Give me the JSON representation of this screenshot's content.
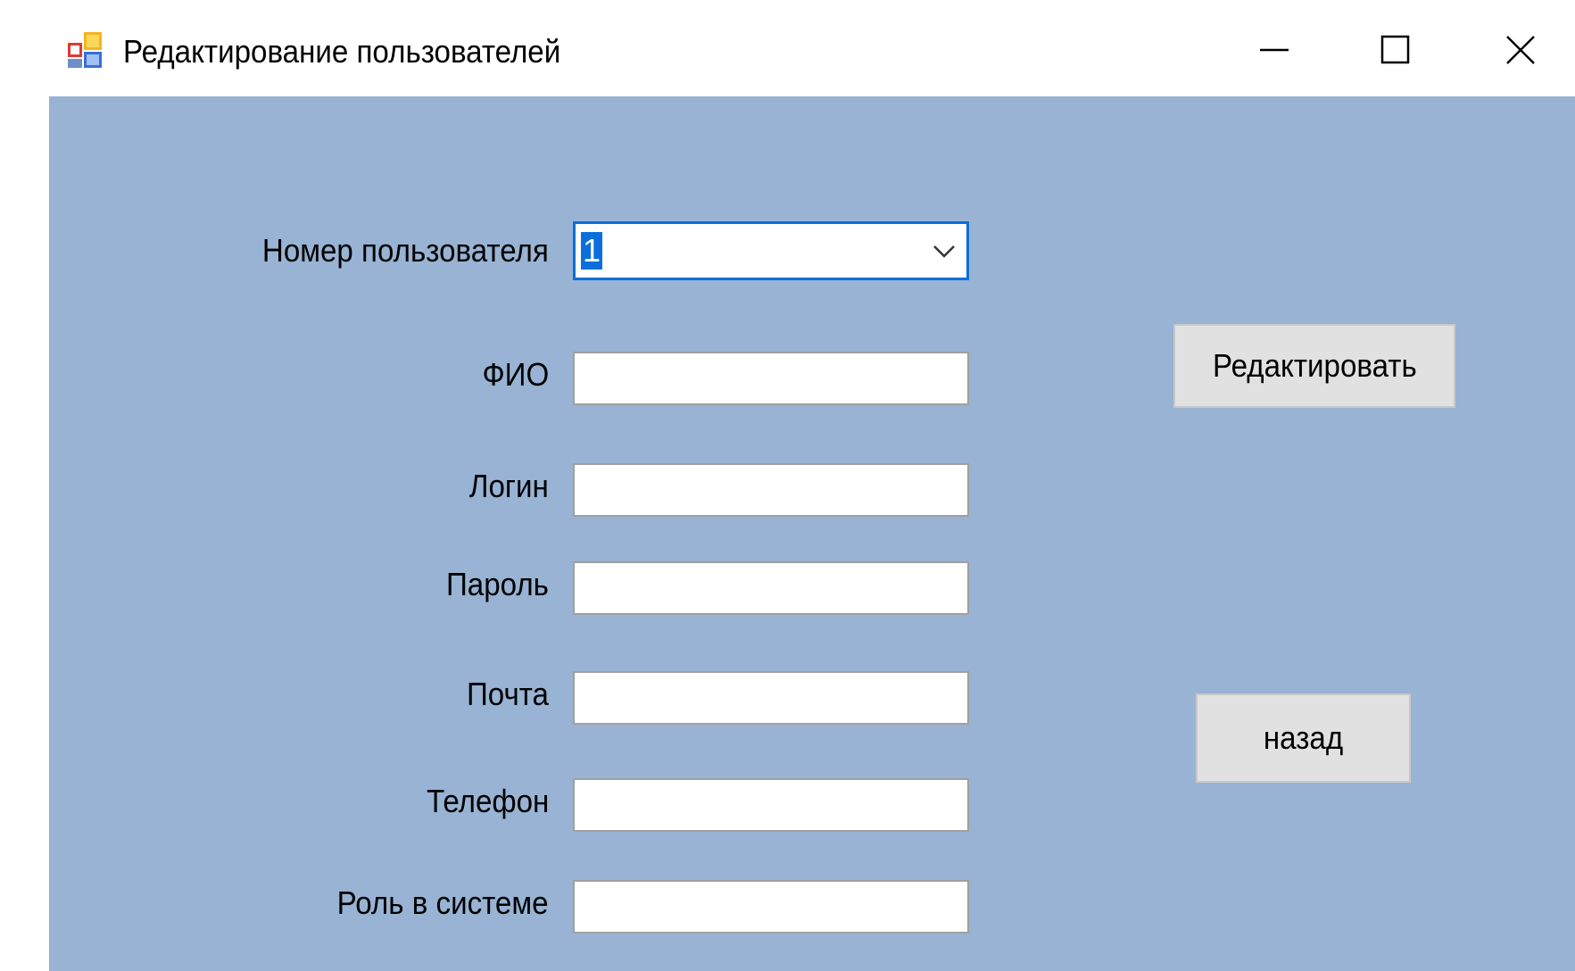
{
  "window": {
    "title": "Редактирование пользователей",
    "icon": "winforms-app-icon",
    "controls": {
      "minimize": "minimize-icon",
      "maximize": "maximize-icon",
      "close": "close-icon"
    }
  },
  "form": {
    "user_number": {
      "label": "Номер пользователя",
      "selected_value": "1"
    },
    "fields": {
      "fio": {
        "label": "ФИО",
        "value": ""
      },
      "login": {
        "label": "Логин",
        "value": ""
      },
      "password": {
        "label": "Пароль",
        "value": ""
      },
      "email": {
        "label": "Почта",
        "value": ""
      },
      "phone": {
        "label": "Телефон",
        "value": ""
      },
      "role": {
        "label": "Роль в системе",
        "value": ""
      }
    }
  },
  "buttons": {
    "edit_label": "Редактировать",
    "back_label": "назад"
  },
  "colors": {
    "client_background": "#98b3d3",
    "focus_border": "#0a6fdc",
    "button_face": "#e1e1e1"
  }
}
